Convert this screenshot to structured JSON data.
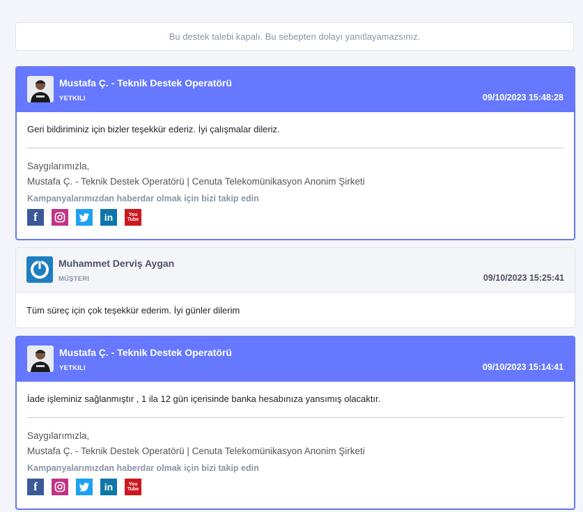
{
  "notice": "Bu destek talebi kapalı. Bu sebepten dolayı yanıtlayamazsınız.",
  "messages": [
    {
      "author": "Mustafa Ç. - Teknik Destek Operatörü",
      "role": "YETKILI",
      "time": "09/10/2023 15:48:28",
      "body": "Geri bildiriminiz için bizler teşekkür ederiz. İyi çalışmalar dileriz.",
      "sig_greeting": "Saygılarımızla,",
      "sig_name": "Mustafa Ç. - Teknik Destek Operatörü | Cenuta Telekomünikasyon Anonim Şirketi",
      "sig_follow": "Kampanyalarımızdan haberdar olmak için bizi takip edin"
    },
    {
      "author": "Muhammet Derviş Aygan",
      "role": "MÜŞTERI",
      "time": "09/10/2023 15:25:41",
      "body": "Tüm süreç için çok teşekkür ederim. İyi günler dilerim"
    },
    {
      "author": "Mustafa Ç. - Teknik Destek Operatörü",
      "role": "YETKILI",
      "time": "09/10/2023 15:14:41",
      "body": "İade işleminiz sağlanmıştır , 1 ila 12 gün içerisinde banka hesabınıza yansımış olacaktır.",
      "sig_greeting": "Saygılarımızla,",
      "sig_name": "Mustafa Ç. - Teknik Destek Operatörü | Cenuta Telekomünikasyon Anonim Şirketi",
      "sig_follow": "Kampanyalarımızdan haberdar olmak için bizi takip edin"
    }
  ],
  "social_icons": [
    "facebook-icon",
    "instagram-icon",
    "twitter-icon",
    "linkedin-icon",
    "youtube-icon"
  ],
  "social_glyphs": {
    "facebook": "f",
    "linkedin": "in",
    "youtube_top": "You",
    "youtube_bottom": "Tube"
  },
  "colors": {
    "staff_header": "#6678ff",
    "client_header": "#f4f5f8",
    "page_bg": "#f4f5fa",
    "muted": "#8a93a6"
  }
}
